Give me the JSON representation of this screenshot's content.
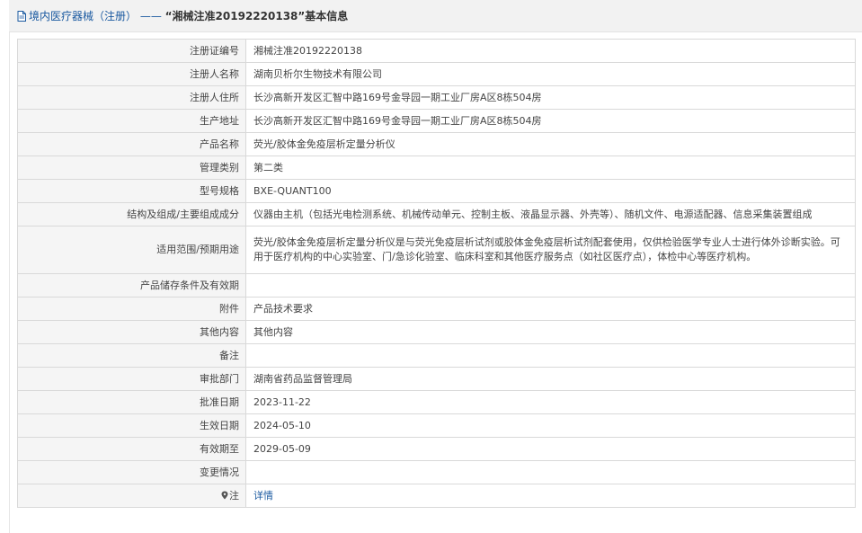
{
  "header": {
    "category": "境内医疗器械（注册）",
    "sep": " —— ",
    "record": "“湘械注准20192220138”",
    "suffix": "基本信息"
  },
  "rows": [
    {
      "label": "注册证编号",
      "value": "湘械注准20192220138"
    },
    {
      "label": "注册人名称",
      "value": "湖南贝析尔生物技术有限公司"
    },
    {
      "label": "注册人住所",
      "value": "长沙高新开发区汇智中路169号金导园一期工业厂房A区8栋504房"
    },
    {
      "label": "生产地址",
      "value": "长沙高新开发区汇智中路169号金导园一期工业厂房A区8栋504房"
    },
    {
      "label": "产品名称",
      "value": "荧光/胶体金免疫层析定量分析仪"
    },
    {
      "label": "管理类别",
      "value": "第二类"
    },
    {
      "label": "型号规格",
      "value": "BXE-QUANT100"
    },
    {
      "label": "结构及组成/主要组成成分",
      "value": "仪器由主机（包括光电检测系统、机械传动单元、控制主板、液晶显示器、外壳等）、随机文件、电源适配器、信息采集装置组成"
    },
    {
      "label": "适用范围/预期用途",
      "value": "荧光/胶体金免疫层析定量分析仪是与荧光免疫层析试剂或胶体金免疫层析试剂配套使用，仅供检验医学专业人士进行体外诊断实验。可用于医疗机构的中心实验室、门/急诊化验室、临床科室和其他医疗服务点（如社区医疗点），体检中心等医疗机构。"
    },
    {
      "label": "产品储存条件及有效期",
      "value": ""
    },
    {
      "label": "附件",
      "value": "产品技术要求"
    },
    {
      "label": "其他内容",
      "value": "其他内容"
    },
    {
      "label": "备注",
      "value": ""
    },
    {
      "label": "审批部门",
      "value": "湖南省药品监督管理局"
    },
    {
      "label": "批准日期",
      "value": "2023-11-22"
    },
    {
      "label": "生效日期",
      "value": "2024-05-10"
    },
    {
      "label": "有效期至",
      "value": "2029-05-09"
    },
    {
      "label": "变更情况",
      "value": ""
    }
  ],
  "note_row": {
    "label": "注",
    "link": "详情"
  }
}
